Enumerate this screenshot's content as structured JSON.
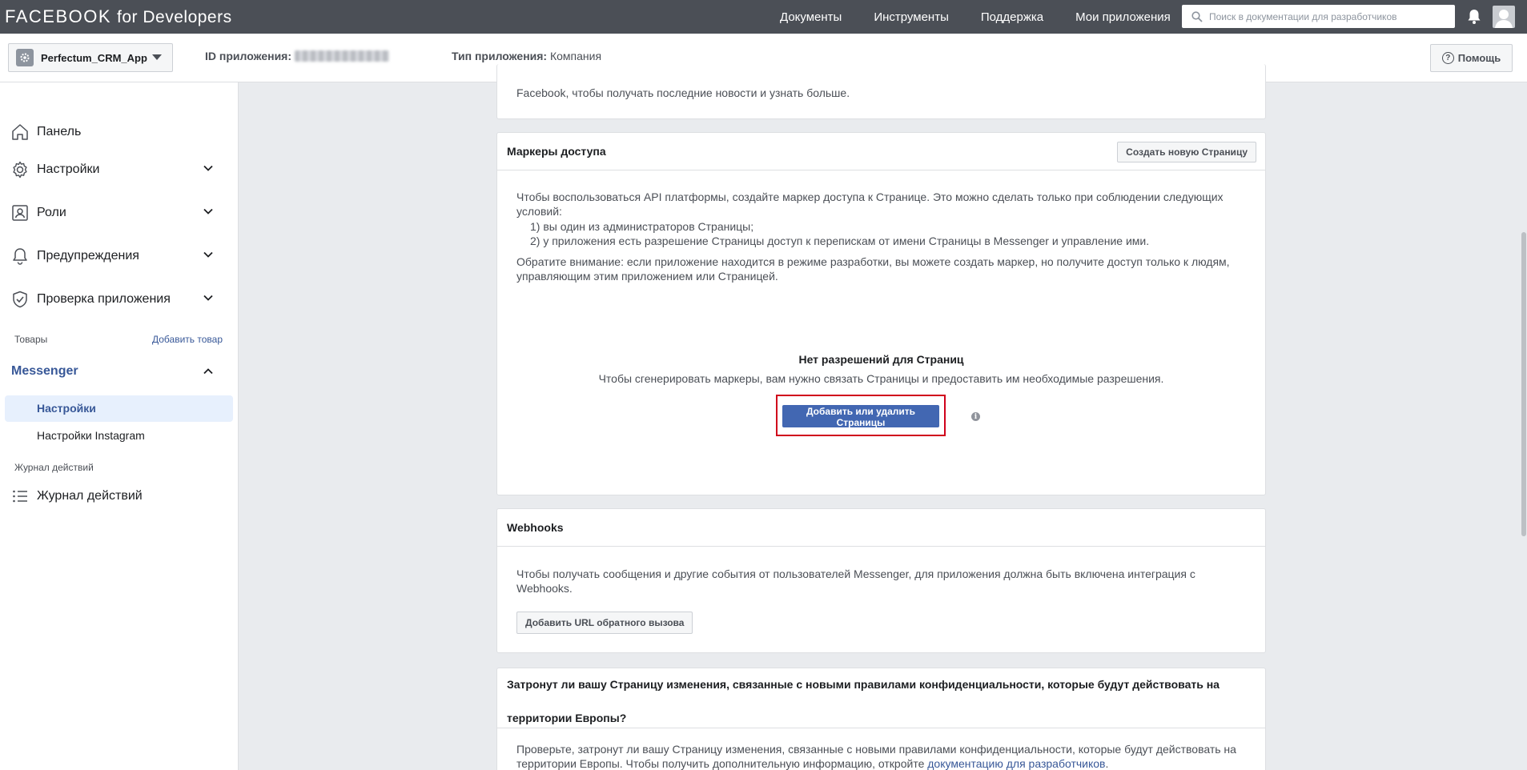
{
  "topbar": {
    "logo_brand": "FACEBOOK",
    "logo_suffix": "for Developers",
    "nav": [
      "Документы",
      "Инструменты",
      "Поддержка",
      "Мои приложения"
    ],
    "search_placeholder": "Поиск в документации для разработчиков"
  },
  "appbar": {
    "app_name": "Perfectum_CRM_App",
    "app_id_label": "ID приложения:",
    "app_type_label": "Тип приложения:",
    "app_type_value": "Компания",
    "help_label": "Помощь"
  },
  "sidebar": {
    "items": [
      {
        "label": "Панель",
        "icon": "home-icon"
      },
      {
        "label": "Настройки",
        "icon": "gear-icon"
      },
      {
        "label": "Роли",
        "icon": "roles-icon"
      },
      {
        "label": "Предупреждения",
        "icon": "bell-icon"
      },
      {
        "label": "Проверка приложения",
        "icon": "shield-check-icon"
      }
    ],
    "products_label": "Товары",
    "add_product_label": "Добавить товар",
    "messenger_label": "Messenger",
    "messenger_sub": [
      "Настройки",
      "Настройки Instagram"
    ],
    "activity_section_label": "Журнал действий",
    "activity_item_label": "Журнал действий"
  },
  "top_card": {
    "text": "Facebook, чтобы получать последние новости и узнать больше."
  },
  "tokens_card": {
    "title": "Маркеры доступа",
    "create_page_button": "Создать новую Страницу",
    "intro": "Чтобы воспользоваться API платформы, создайте маркер доступа к Странице. Это можно сделать только при соблюдении следующих условий:",
    "conditions": [
      "1) вы один из администраторов Страницы;",
      "2) у приложения есть разрешение Страницы доступ к перепискам от имени Страницы в Messenger и управление ими."
    ],
    "note": "Обратите внимание: если приложение находится в режиме разработки, вы можете создать маркер, но получите доступ только к людям, управляющим этим приложением или Страницей.",
    "empty_title": "Нет разрешений для Страниц",
    "empty_text": "Чтобы сгенерировать маркеры, вам нужно связать Страницы и предоставить им необходимые разрешения.",
    "add_pages_button": "Добавить или удалить Страницы",
    "highlight_color": "#d0021b"
  },
  "webhooks_card": {
    "title": "Webhooks",
    "text": "Чтобы получать сообщения и другие события от пользователей Messenger, для приложения должна быть включена интеграция с Webhooks.",
    "callback_button": "Добавить URL обратного вызова"
  },
  "privacy_card": {
    "title_line1": "Затронут ли вашу Страницу изменения, связанные с новыми правилами конфиденциальности, которые будут действовать на",
    "title_line2": "территории Европы?",
    "text": "Проверьте, затронут ли вашу Страницу изменения, связанные с новыми правилами конфиденциальности, которые будут действовать на территории Европы. Чтобы получить дополнительную информацию, откройте ",
    "link": "документацию для разработчиков",
    "text_end": "."
  },
  "colors": {
    "topbar": "#4b4f56",
    "accent": "#385898",
    "primary_button": "#4267b2"
  }
}
